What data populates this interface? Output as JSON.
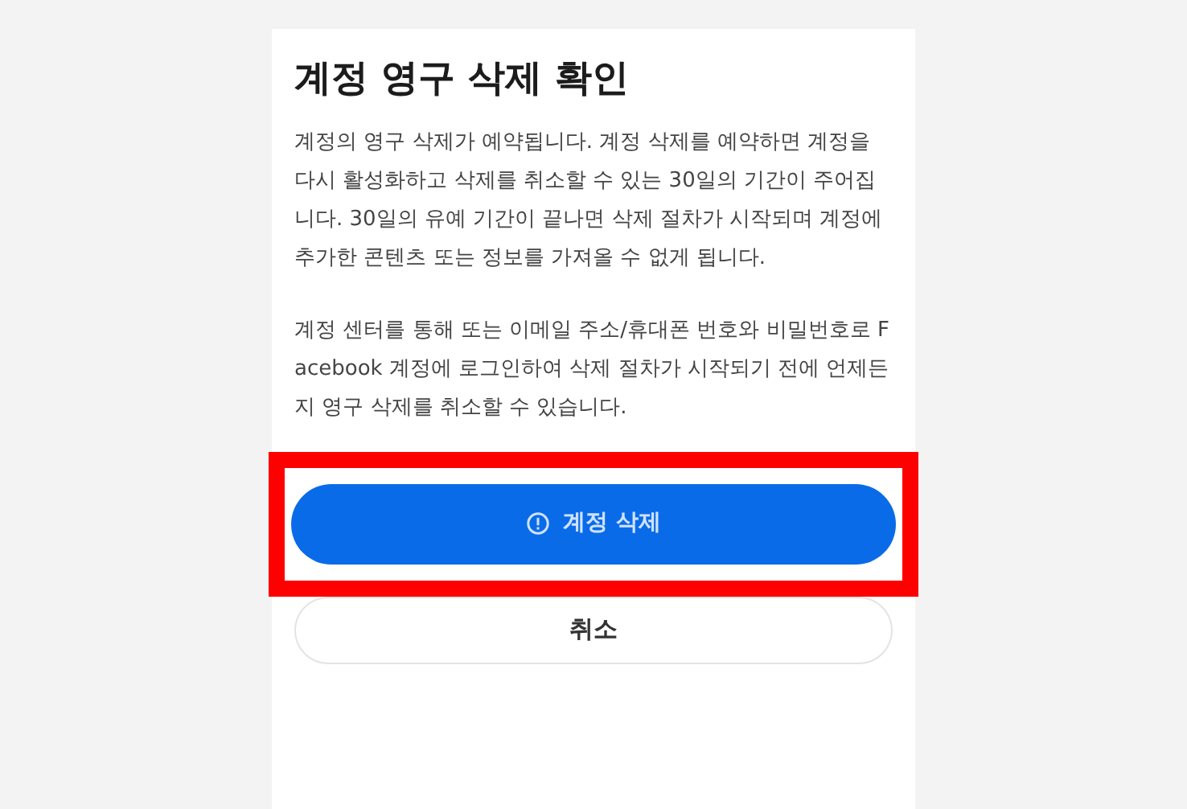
{
  "dialog": {
    "title": "계정 영구 삭제 확인",
    "paragraphs": [
      "계정의 영구 삭제가 예약됩니다. 계정 삭제를 예약하면 계정을 다시 활성화하고 삭제를 취소할 수 있는 30일의 기간이 주어집니다. 30일의 유예 기간이 끝나면 삭제 절차가 시작되며 계정에 추가한 콘텐츠 또는 정보를 가져올 수 없게 됩니다.",
      "계정 센터를 통해 또는 이메일 주소/휴대폰 번호와 비밀번호로 Facebook 계정에 로그인하여 삭제 절차가 시작되기 전에 언제든지 영구 삭제를 취소할 수 있습니다."
    ],
    "buttons": [
      {
        "kind": "primary",
        "label": "계정 삭제",
        "highlighted": true
      },
      {
        "kind": "secondary",
        "label": "취소",
        "highlighted": false
      }
    ]
  }
}
